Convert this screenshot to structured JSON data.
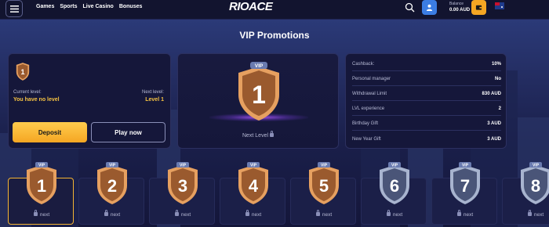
{
  "header": {
    "nav": [
      "Games",
      "Sports",
      "Live Casino",
      "Bonuses"
    ],
    "logo": "RIOACE",
    "balance_label": "Balance",
    "balance_value": "0.00 AUD"
  },
  "page_title": "VIP Promotions",
  "current": {
    "badge_level": "1",
    "current_level_label": "Current level:",
    "current_level_value": "You have no level",
    "next_level_label": "Next level:",
    "next_level_value": "Level 1",
    "deposit_label": "Deposit",
    "play_label": "Play now"
  },
  "center": {
    "badge_tag": "VIP",
    "badge_level": "1",
    "next_level_text": "Next Level"
  },
  "benefits": [
    {
      "label": "Cashback:",
      "value": "10%"
    },
    {
      "label": "Personal manager",
      "value": "No"
    },
    {
      "label": "Withdrawal Limit",
      "value": "830 AUD"
    },
    {
      "label": "LVL experience",
      "value": "2"
    },
    {
      "label": "Birthday Gift",
      "value": "3 AUD"
    },
    {
      "label": "New Year Gift",
      "value": "3 AUD"
    }
  ],
  "levels": [
    {
      "num": "1",
      "tag": "VIP",
      "label": "next",
      "tier": "bronze",
      "active": true
    },
    {
      "num": "2",
      "tag": "VIP",
      "label": "next",
      "tier": "bronze",
      "active": false
    },
    {
      "num": "3",
      "tag": "VIP",
      "label": "next",
      "tier": "bronze",
      "active": false
    },
    {
      "num": "4",
      "tag": "VIP",
      "label": "next",
      "tier": "bronze",
      "active": false
    },
    {
      "num": "5",
      "tag": "VIP",
      "label": "next",
      "tier": "bronze",
      "active": false
    },
    {
      "num": "6",
      "tag": "VIP",
      "label": "next",
      "tier": "silver",
      "active": false
    },
    {
      "num": "7",
      "tag": "VIP",
      "label": "next",
      "tier": "silver",
      "active": false
    },
    {
      "num": "8",
      "tag": "VIP",
      "label": "next",
      "tier": "silver",
      "active": false
    }
  ],
  "colors": {
    "accent": "#f5a623",
    "user_button": "#3b7de3",
    "bronze_fill": "#9a5a2e",
    "bronze_rim": "#e6a060",
    "silver_fill": "#4a5578",
    "silver_rim": "#a8b4cf"
  }
}
